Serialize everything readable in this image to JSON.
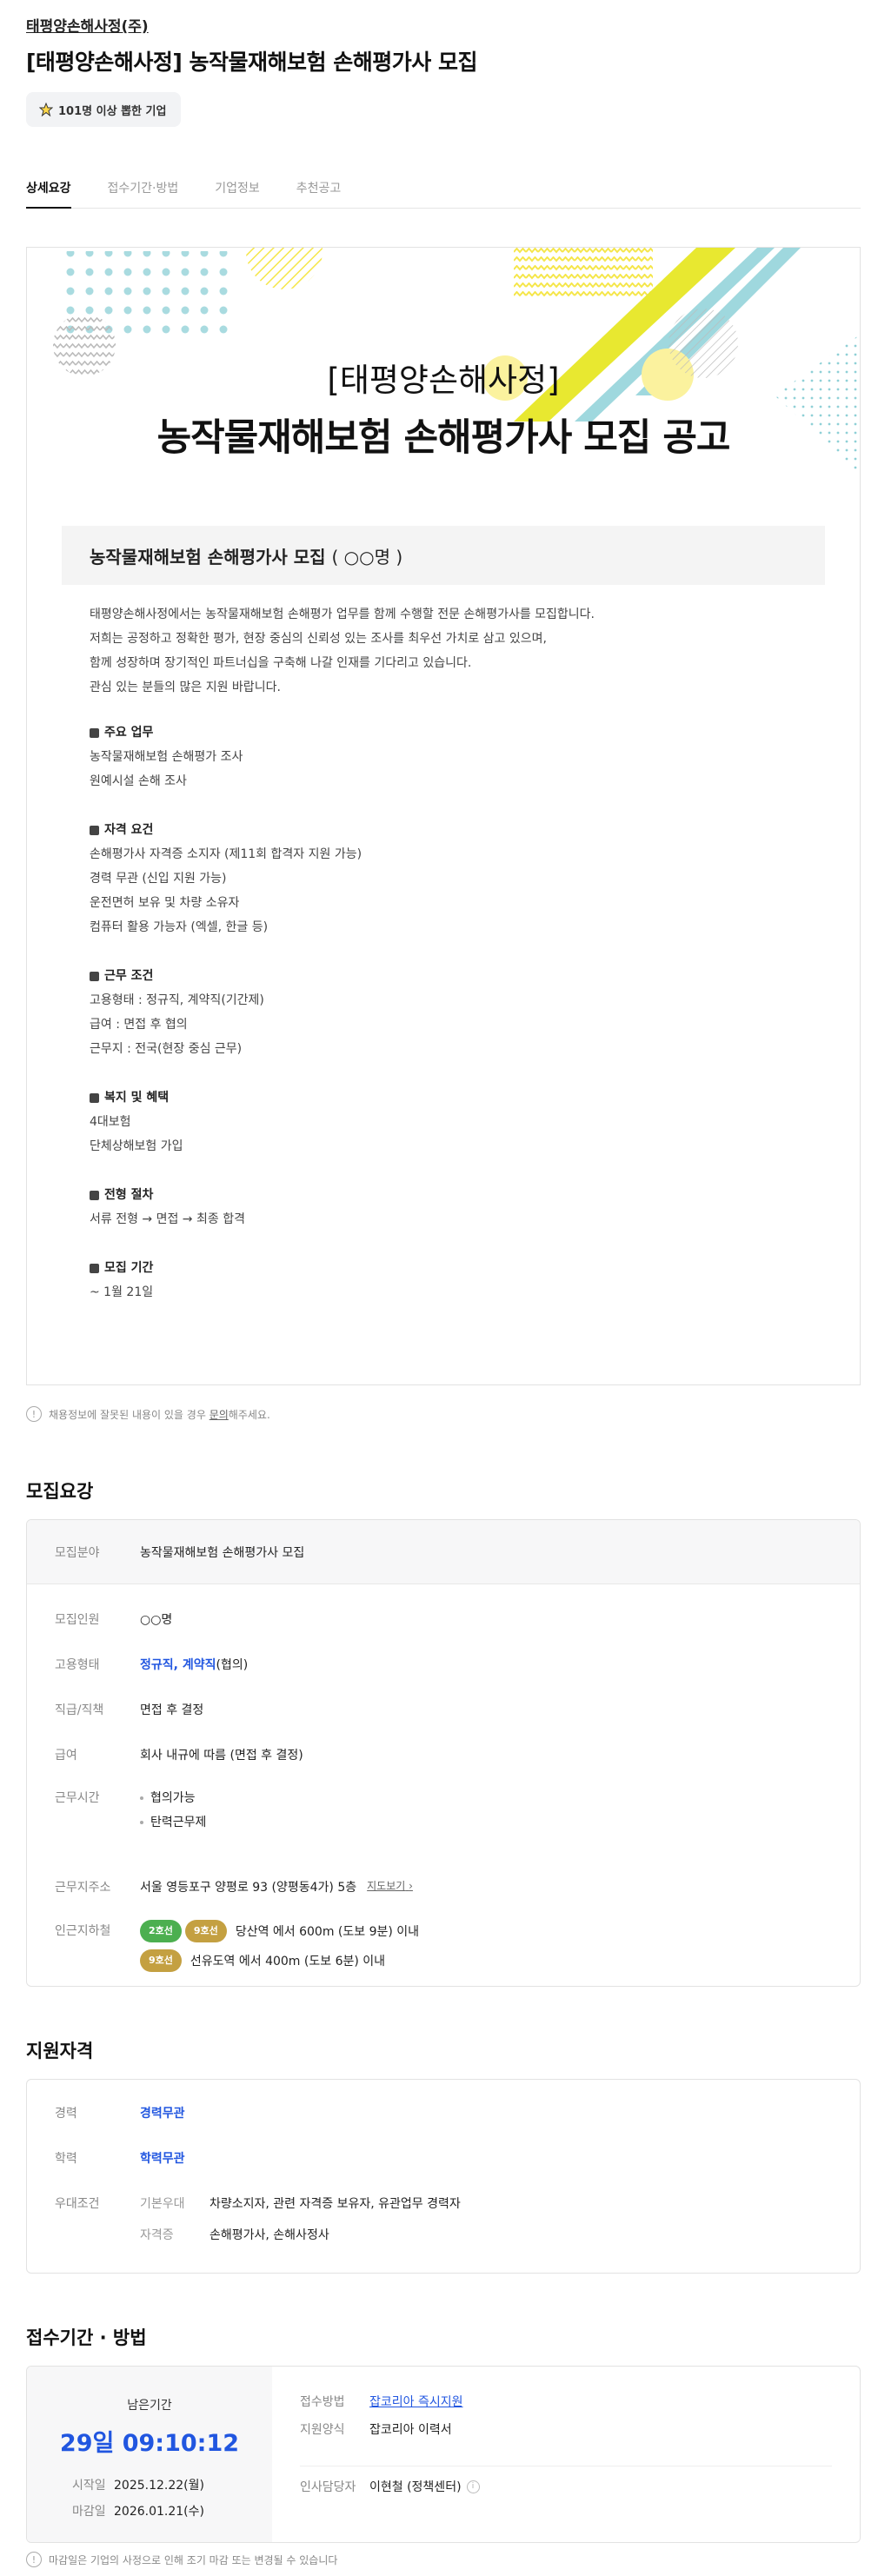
{
  "header": {
    "company": "태평양손해사정(주)",
    "title": "[태평양손해사정] 농작물재해보험 손해평가사 모집",
    "badge": "101명 이상 뽑한 기업"
  },
  "tabs": [
    "상세요강",
    "접수기간·방법",
    "기업정보",
    "추천공고"
  ],
  "poster": {
    "subtitle": "[태평양손해사정]",
    "title": "농작물재해보험 손해평가사 모집 공고",
    "section_title": "농작물재해보험 손해평가사 모집",
    "section_count": "( ○○명 )",
    "intro": [
      "태평양손해사정에서는 농작물재해보험 손해평가 업무를 함께 수행할 전문 손해평가사를 모집합니다.",
      "저희는 공정하고 정확한 평가, 현장 중심의 신뢰성 있는 조사를 최우선 가치로 삼고 있으며,",
      "함께 성장하며 장기적인 파트너십을 구축해 나갈 인재를 기다리고 있습니다.",
      "관심 있는 분들의 많은 지원 바랍니다."
    ],
    "blocks": [
      {
        "heading": "주요 업무",
        "lines": [
          "농작물재해보험 손해평가 조사",
          "원예시설 손해 조사"
        ]
      },
      {
        "heading": "자격 요건",
        "lines": [
          "손해평가사 자격증 소지자 (제11회 합격자 지원 가능)",
          "경력 무관 (신입 지원 가능)",
          "운전면허 보유 및 차량 소유자",
          "컴퓨터 활용 가능자 (엑셀, 한글 등)"
        ]
      },
      {
        "heading": "근무 조건",
        "lines": [
          "고용형태 : 정규직, 계약직(기간제)",
          "급여 : 면접 후 협의",
          "근무지 : 전국(현장 중심 근무)"
        ]
      },
      {
        "heading": "복지 및 혜택",
        "lines": [
          "4대보험",
          "단체상해보험 가입"
        ]
      },
      {
        "heading": "전형 절차",
        "lines": [
          "서류 전형 → 면접 → 최종 합격"
        ]
      },
      {
        "heading": "모집 기간",
        "lines": [
          "~ 1월 21일"
        ]
      }
    ]
  },
  "notice1": {
    "before": "채용정보에 잘못된 내용이 있을 경우 ",
    "link": "문의",
    "after": "해주세요."
  },
  "recruit": {
    "heading": "모집요강",
    "field_label": "모집분야",
    "field_value": "농작물재해보험 손해평가사 모집",
    "count_label": "모집인원",
    "count_value": "○○명",
    "type_label": "고용형태",
    "type_blue": "정규직, 계약직",
    "type_rest": "(협의)",
    "rank_label": "직급/직책",
    "rank_value": "면접 후 결정",
    "salary_label": "급여",
    "salary_value": "회사 내규에 따름 (면접 후 결정)",
    "hours_label": "근무시간",
    "hours_values": [
      "협의가능",
      "탄력근무제"
    ],
    "address_label": "근무지주소",
    "address_value": "서울 영등포구 양평로 93 (양평동4가) 5층",
    "map_link": "지도보기",
    "subway_label": "인근지하철",
    "subway_line1_tags": [
      "2호선",
      "9호선"
    ],
    "subway_line1_text": "당산역 에서 600m (도보 9분) 이내",
    "subway_line2_tags": [
      "9호선"
    ],
    "subway_line2_text": "선유도역 에서 400m (도보 6분) 이내",
    "colors": {
      "line2": "#4caf50",
      "line9": "#c4a041"
    }
  },
  "qualification": {
    "heading": "지원자격",
    "career_label": "경력",
    "career_value": "경력무관",
    "edu_label": "학력",
    "edu_value": "학력무관",
    "pref_label": "우대조건",
    "pref_sub1_label": "기본우대",
    "pref_sub1_value": "차량소지자, 관련 자격증 보유자, 유관업무 경력자",
    "pref_sub2_label": "자격증",
    "pref_sub2_value": "손해평가사, 손해사정사"
  },
  "apply": {
    "heading": "접수기간 · 방법",
    "remain_label": "남은기간",
    "remain_value": "29일 09:10:12",
    "start_label": "시작일",
    "start_value": "2025.12.22(월)",
    "end_label": "마감일",
    "end_value": "2026.01.21(수)",
    "method_label": "접수방법",
    "method_value": "잡코리아 즉시지원",
    "form_label": "지원양식",
    "form_value": "잡코리아 이력서",
    "hr_label": "인사담당자",
    "hr_value": "이현철 (정책센터)"
  },
  "notice2": "마감일은 기업의 사정으로 인해 조기 마감 또는 변경될 수 있습니다",
  "accent": "#2156e0"
}
